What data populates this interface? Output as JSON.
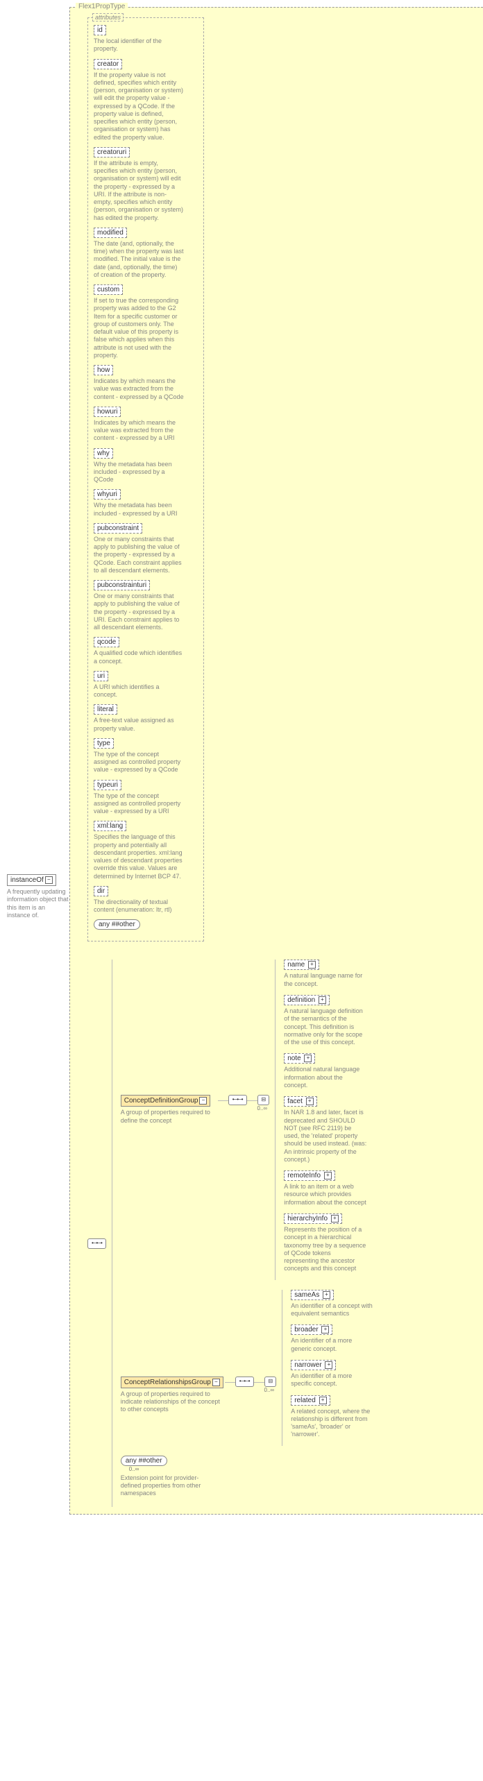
{
  "root": {
    "name": "instanceOf",
    "desc": "A frequently updating information object that this item is an instance of."
  },
  "mainType": {
    "legend": "Flex1PropType"
  },
  "attributes": {
    "legend": "attributes",
    "items": [
      {
        "name": "id",
        "desc": "The local identifier of the property."
      },
      {
        "name": "creator",
        "desc": "If the property value is not defined, specifies which entity (person, organisation or system) will edit the property value - expressed by a QCode. If the property value is defined, specifies which entity (person, organisation or system) has edited the property value."
      },
      {
        "name": "creatoruri",
        "desc": "If the attribute is empty, specifies which entity (person, organisation or system) will edit the property - expressed by a URI. If the attribute is non-empty, specifies which entity (person, organisation or system) has edited the property."
      },
      {
        "name": "modified",
        "desc": "The date (and, optionally, the time) when the property was last modified. The initial value is the date (and, optionally, the time) of creation of the property."
      },
      {
        "name": "custom",
        "desc": "If set to true the corresponding property was added to the G2 Item for a specific customer or group of customers only. The default value of this property is false which applies when this attribute is not used with the property."
      },
      {
        "name": "how",
        "desc": "Indicates by which means the value was extracted from the content - expressed by a QCode"
      },
      {
        "name": "howuri",
        "desc": "Indicates by which means the value was extracted from the content - expressed by a URI"
      },
      {
        "name": "why",
        "desc": "Why the metadata has been included - expressed by a QCode"
      },
      {
        "name": "whyuri",
        "desc": "Why the metadata has been included - expressed by a URI"
      },
      {
        "name": "pubconstraint",
        "desc": "One or many constraints that apply to publishing the value of the property - expressed by a QCode. Each constraint applies to all descendant elements."
      },
      {
        "name": "pubconstrainturi",
        "desc": "One or many constraints that apply to publishing the value of the property - expressed by a URI. Each constraint applies to all descendant elements."
      },
      {
        "name": "qcode",
        "desc": "A qualified code which identifies a concept."
      },
      {
        "name": "uri",
        "desc": "A URI which identifies a concept."
      },
      {
        "name": "literal",
        "desc": "A free-text value assigned as property value."
      },
      {
        "name": "type",
        "desc": "The type of the concept assigned as controlled property value - expressed by a QCode"
      },
      {
        "name": "typeuri",
        "desc": "The type of the concept assigned as controlled property value - expressed by a URI"
      },
      {
        "name": "xml:lang",
        "desc": "Specifies the language of this property and potentially all descendant properties. xml:lang values of descendant properties override this value. Values are determined by Internet BCP 47."
      },
      {
        "name": "dir",
        "desc": "The directionality of textual content (enumeration: ltr, rtl)"
      }
    ],
    "anyOther": "any ##other"
  },
  "groups": {
    "def": {
      "name": "ConceptDefinitionGroup",
      "desc": "A group of properties required to define the concept",
      "card": "0..∞",
      "items": [
        {
          "name": "name",
          "desc": "A natural language name for the concept."
        },
        {
          "name": "definition",
          "desc": "A natural language definition of the semantics of the concept. This definition is normative only for the scope of the use of this concept."
        },
        {
          "name": "note",
          "desc": "Additional natural language information about the concept."
        },
        {
          "name": "facet",
          "desc": "In NAR 1.8 and later, facet is deprecated and SHOULD NOT (see RFC 2119) be used, the 'related' property should be used instead. (was: An intrinsic property of the concept.)"
        },
        {
          "name": "remoteInfo",
          "desc": "A link to an item or a web resource which provides information about the concept"
        },
        {
          "name": "hierarchyInfo",
          "desc": "Represents the position of a concept in a hierarchical taxonomy tree by a sequence of QCode tokens representing the ancestor concepts and this concept"
        }
      ]
    },
    "rel": {
      "name": "ConceptRelationshipsGroup",
      "desc": "A group of properties required to indicate relationships of the concept to other concepts",
      "card": "0..∞",
      "items": [
        {
          "name": "sameAs",
          "desc": "An identifier of a concept with equivalent semantics"
        },
        {
          "name": "broader",
          "desc": "An identifier of a more generic concept."
        },
        {
          "name": "narrower",
          "desc": "An identifier of a more specific concept."
        },
        {
          "name": "related",
          "desc": "A related concept, where the relationship is different from 'sameAs', 'broader' or 'narrower'."
        }
      ]
    },
    "anyOther": {
      "label": "any ##other",
      "card": "0..∞",
      "desc": "Extension point for provider-defined properties from other namespaces"
    }
  }
}
